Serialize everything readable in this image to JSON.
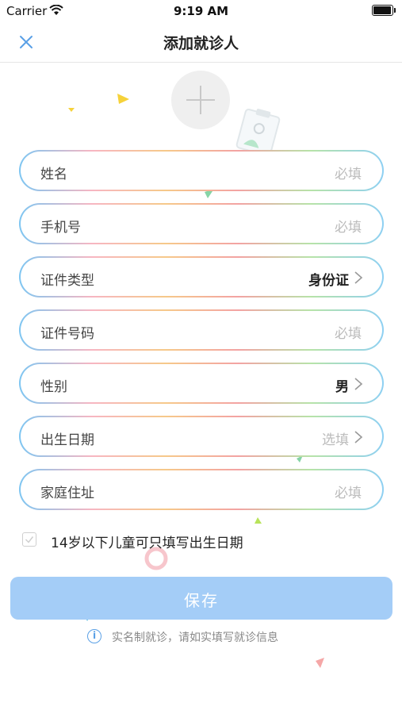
{
  "status_bar": {
    "carrier": "Carrier",
    "time": "9:19 AM"
  },
  "nav": {
    "title": "添加就诊人"
  },
  "form": {
    "fields": [
      {
        "label": "姓名",
        "value": "必填"
      },
      {
        "label": "手机号",
        "value": "必填"
      },
      {
        "label": "证件类型",
        "value": "身份证"
      },
      {
        "label": "证件号码",
        "value": "必填"
      },
      {
        "label": "性别",
        "value": "男"
      },
      {
        "label": "出生日期",
        "value": "选填"
      },
      {
        "label": "家庭住址",
        "value": "必填"
      }
    ],
    "child_option": "14岁以下儿童可只填写出生日期"
  },
  "save_button": {
    "label": "保存"
  },
  "notice": {
    "text": "实名制就诊，请如实填写就诊信息"
  },
  "colors": {
    "accent": "#5aa0e6",
    "save_bg": "#a4cdf7"
  },
  "icons": [
    "wifi-icon",
    "battery-icon",
    "close-icon",
    "plus-icon",
    "chevron-right-icon",
    "check-icon",
    "info-icon"
  ]
}
